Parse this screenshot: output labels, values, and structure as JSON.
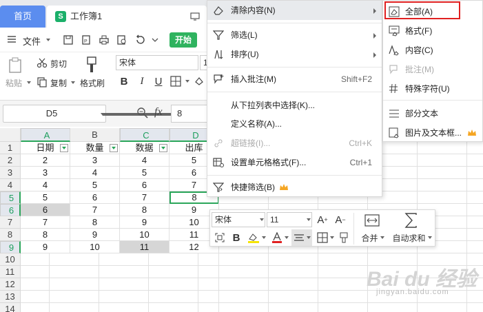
{
  "tabs": {
    "home": "首页",
    "workbook": "工作簿1",
    "workbook_icon": "S"
  },
  "toolbar": {
    "file": "文件",
    "start": "开始",
    "cut": "剪切",
    "copy": "复制",
    "paste": "粘贴",
    "format_painter": "格式刷",
    "font_name": "宋体",
    "font_size": "1"
  },
  "formula_bar": {
    "cell_ref": "D5",
    "fx": "fx",
    "value": "8"
  },
  "columns": [
    "A",
    "B",
    "C",
    "D"
  ],
  "rows": [
    "1",
    "2",
    "3",
    "4",
    "5",
    "6",
    "7",
    "8",
    "9",
    "10",
    "11",
    "12",
    "13",
    "14"
  ],
  "table": {
    "headers": [
      "日期",
      "数量",
      "数据",
      "出库"
    ],
    "data": [
      [
        "2",
        "3",
        "4",
        "5"
      ],
      [
        "3",
        "4",
        "5",
        "6"
      ],
      [
        "4",
        "5",
        "6",
        "7"
      ],
      [
        "5",
        "6",
        "7",
        "8"
      ],
      [
        "6",
        "7",
        "8",
        "9"
      ],
      [
        "7",
        "8",
        "9",
        "10"
      ],
      [
        "8",
        "9",
        "10",
        "11"
      ],
      [
        "9",
        "10",
        "11",
        "12"
      ]
    ]
  },
  "context_menu": {
    "clear_content": "清除内容(N)",
    "filter": "筛选(L)",
    "sort": "排序(U)",
    "insert_comment": "插入批注(M)",
    "insert_comment_shortcut": "Shift+F2",
    "pick_from_list": "从下拉列表中选择(K)...",
    "define_name": "定义名称(A)...",
    "hyperlink": "超链接(I)...",
    "hyperlink_shortcut": "Ctrl+K",
    "format_cells": "设置单元格格式(F)...",
    "format_cells_shortcut": "Ctrl+1",
    "quick_filter": "快捷筛选(B)"
  },
  "submenu": {
    "all": "全部(A)",
    "format": "格式(F)",
    "content": "内容(C)",
    "comment": "批注(M)",
    "special_chars": "特殊字符(U)",
    "partial_text": "部分文本",
    "images_textbox": "图片及文本框..."
  },
  "mini_toolbar": {
    "font_name": "宋体",
    "font_size": "11",
    "merge": "合并",
    "autosum": "自动求和"
  },
  "watermark": {
    "logo": "Bai du 经验",
    "url": "jingyan.baidu.com"
  },
  "colors": {
    "accent_green": "#2aa65a",
    "home_tab": "#5b8def",
    "start_btn": "#2fb35f",
    "crown": "#f5a623",
    "red_box": "#e02020"
  }
}
